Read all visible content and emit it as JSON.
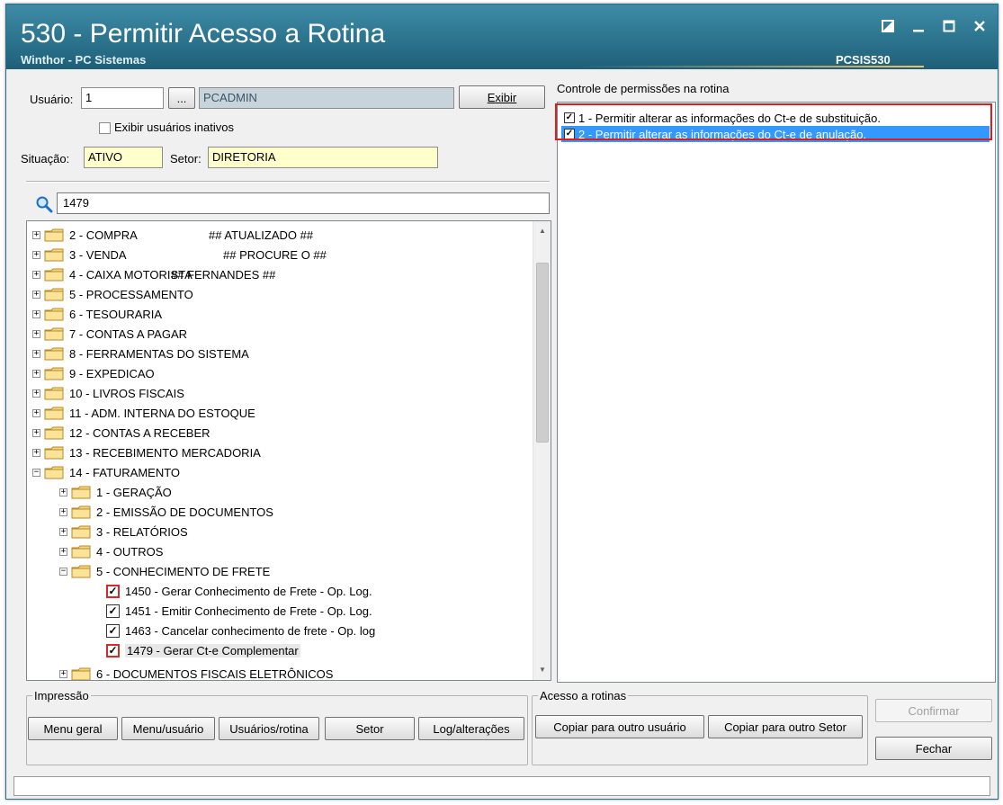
{
  "window": {
    "title": "530 - Permitir Acesso a Rotina",
    "subtitle": "Winthor - PC Sistemas",
    "code": "PCSIS530"
  },
  "user": {
    "label": "Usuário:",
    "value": "1",
    "browse": "...",
    "name": "PCADMIN",
    "exibir": "Exibir",
    "inactive_label": "Exibir usuários inativos",
    "situacao_label": "Situação:",
    "situacao": "ATIVO",
    "setor_label": "Setor:",
    "setor": "DIRETORIA"
  },
  "search": {
    "value": "1479"
  },
  "tree": {
    "items": [
      {
        "label": "2 - COMPRA",
        "note": "## ATUALIZADO ##"
      },
      {
        "label": "3 - VENDA",
        "note": "## PROCURE O ##"
      },
      {
        "label": "4 - CAIXA MOTORISTA",
        "note": "## FERNANDES ##"
      },
      {
        "label": "5 - PROCESSAMENTO"
      },
      {
        "label": "6 - TESOURARIA"
      },
      {
        "label": "7 - CONTAS A PAGAR"
      },
      {
        "label": "8 - FERRAMENTAS DO SISTEMA"
      },
      {
        "label": "9 - EXPEDICAO"
      },
      {
        "label": "10 - LIVROS FISCAIS"
      },
      {
        "label": "11 - ADM. INTERNA DO ESTOQUE"
      },
      {
        "label": "12 - CONTAS A RECEBER"
      },
      {
        "label": "13 - RECEBIMENTO MERCADORIA"
      },
      {
        "label": "14 - FATURAMENTO"
      }
    ],
    "sub_items": [
      {
        "label": "1 - GERAÇÃO"
      },
      {
        "label": "2 - EMISSÃO DE DOCUMENTOS"
      },
      {
        "label": "3 - RELATÓRIOS"
      },
      {
        "label": "4 - OUTROS"
      },
      {
        "label": "5 - CONHECIMENTO DE FRETE"
      }
    ],
    "routines": [
      {
        "label": "1450 - Gerar Conhecimento de Frete - Op. Log."
      },
      {
        "label": "1451 - Emitir Conhecimento de Frete - Op. Log."
      },
      {
        "label": "1463 - Cancelar conhecimento de frete - Op. log"
      },
      {
        "label": "1479 - Gerar Ct-e Complementar"
      }
    ],
    "partial": "6 - DOCUMENTOS FISCAIS ELETRÔNICOS"
  },
  "permissions": {
    "title": "Controle de permissões na rotina",
    "items": [
      {
        "label": "1 - Permitir alterar as informações do Ct-e de substituição."
      },
      {
        "label": "2 - Permitir alterar as informações do Ct-e de anulação."
      }
    ]
  },
  "impressao": {
    "title": "Impressão",
    "buttons": [
      "Menu geral",
      "Menu/usuário",
      "Usuários/rotina",
      "Setor",
      "Log/alterações"
    ]
  },
  "acesso": {
    "title": "Acesso a rotinas",
    "buttons": [
      "Copiar para outro usuário",
      "Copiar para outro Setor"
    ]
  },
  "actions": {
    "confirm": "Confirmar",
    "close": "Fechar"
  },
  "colors": {
    "title_bar": "#2f7892",
    "selection": "#3399ff",
    "highlight_box": "#e11b1b",
    "field_yellow": "#ffffcc"
  },
  "icons": [
    "search-icon",
    "folder-icon",
    "minimize-icon",
    "maximize-icon",
    "close-icon",
    "restore-icon"
  ]
}
